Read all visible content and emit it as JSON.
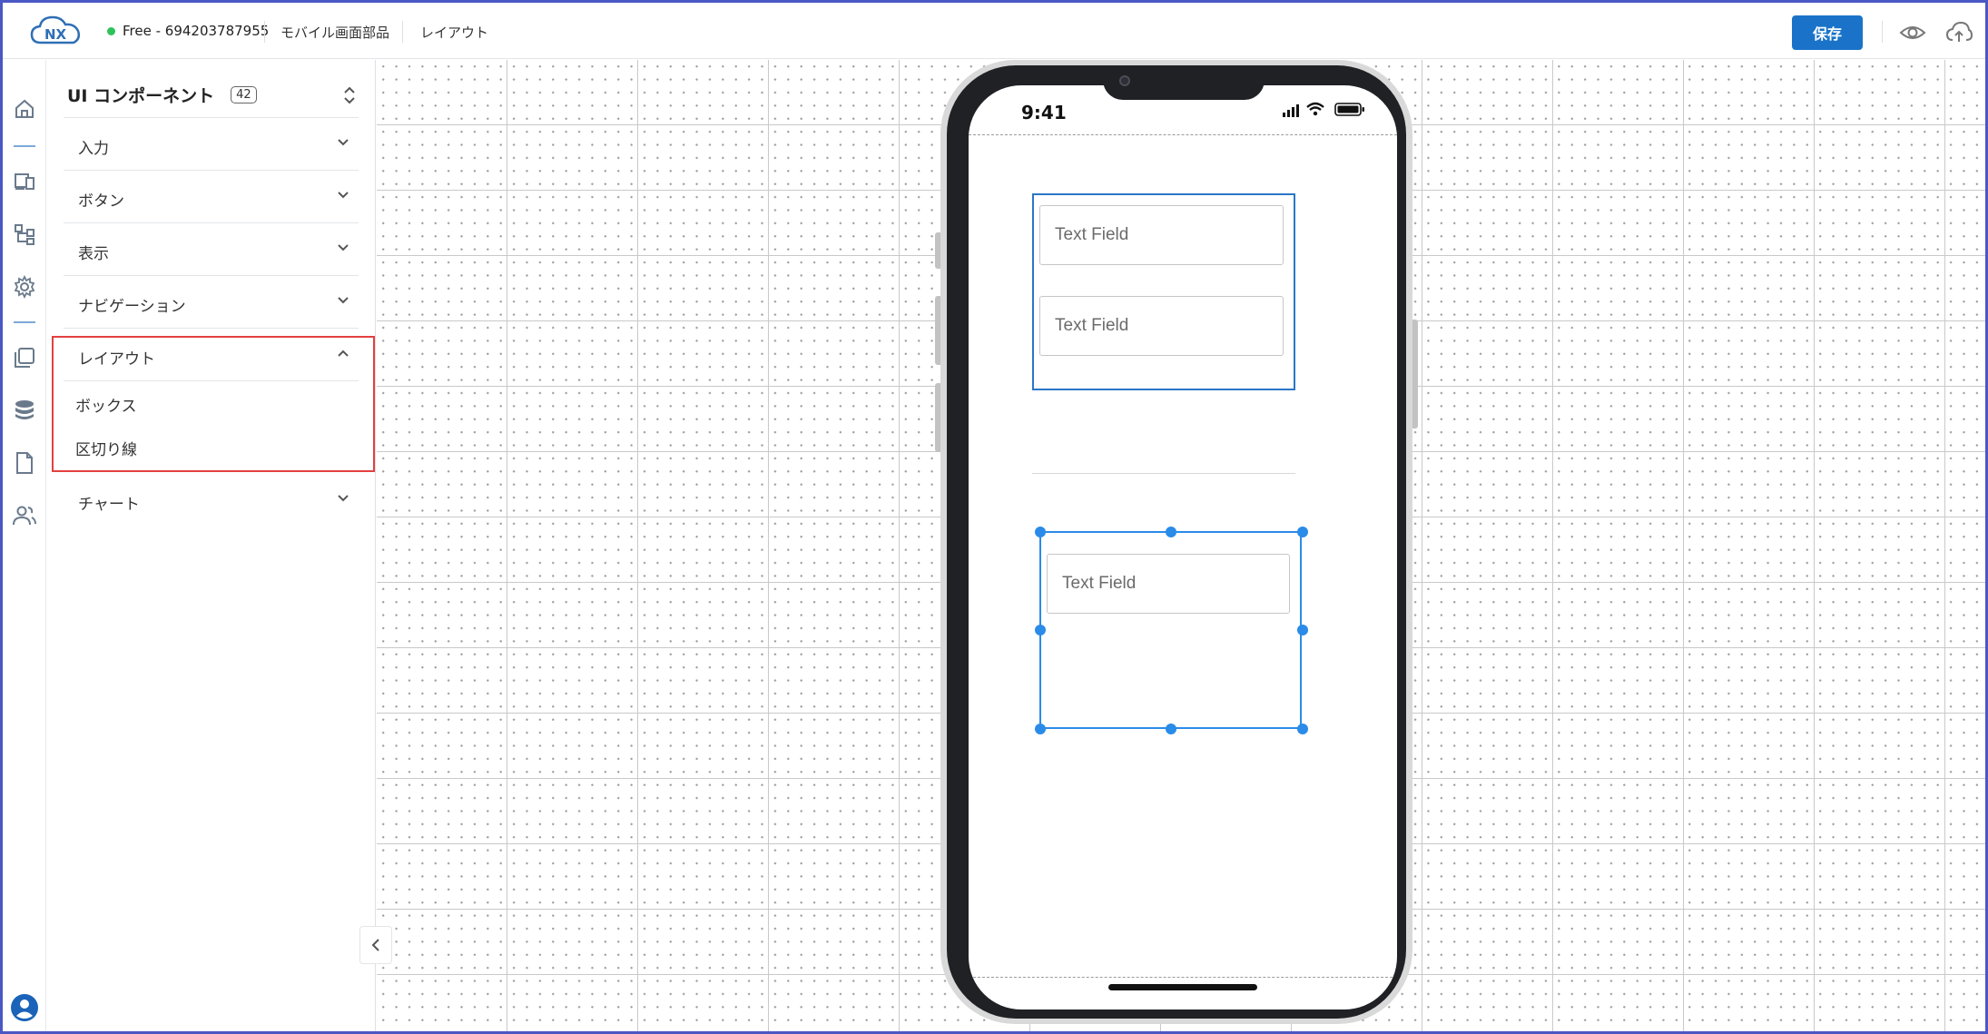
{
  "app": {
    "logo_text": "NX",
    "plan": "Free - 694203787955",
    "breadcrumb": [
      "モバイル画面部品",
      "レイアウト"
    ],
    "save_label": "保存",
    "accent_color": "#1a73c9",
    "status_color": "#2fc25b"
  },
  "rail": {
    "icons": [
      "home-icon",
      "devices-icon",
      "flow-icon",
      "settings-icon",
      "pages-icon",
      "database-icon",
      "document-icon",
      "users-icon",
      "account-icon"
    ]
  },
  "panel": {
    "title": "UI コンポーネント",
    "count": "42",
    "sections": [
      {
        "label": "入力",
        "expanded": false
      },
      {
        "label": "ボタン",
        "expanded": false
      },
      {
        "label": "表示",
        "expanded": false
      },
      {
        "label": "ナビゲーション",
        "expanded": false
      },
      {
        "label": "レイアウト",
        "expanded": true,
        "items": [
          "ボックス",
          "区切り線"
        ]
      },
      {
        "label": "チャート",
        "expanded": false
      }
    ]
  },
  "phone": {
    "time": "9:41"
  },
  "canvas": {
    "box1_fields": [
      "Text Field",
      "Text Field"
    ],
    "box2_fields": [
      "Text Field"
    ]
  }
}
